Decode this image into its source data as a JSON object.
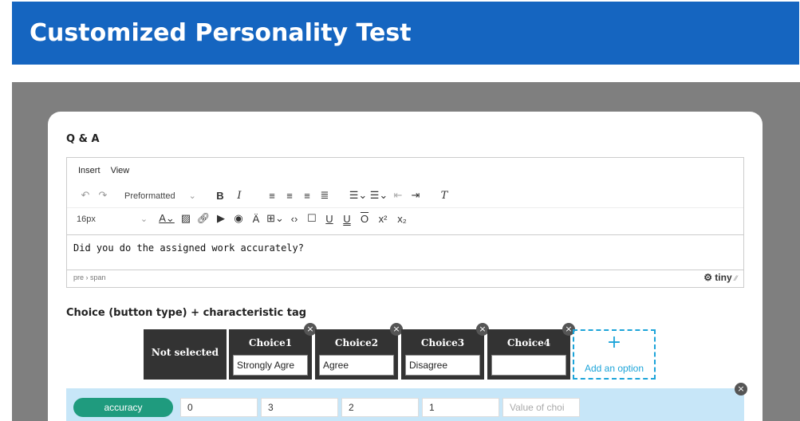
{
  "header": {
    "title": "Customized Personality Test"
  },
  "qa": {
    "label": "Q & A",
    "menu": [
      "Insert",
      "View"
    ],
    "toolbar": {
      "format_select": "Preformatted",
      "size_select": "16px"
    },
    "content": "Did you do the assigned work accurately?",
    "statusbar_path": "pre › span",
    "brand": "tiny"
  },
  "choices": {
    "label": "Choice (button type) + characteristic tag",
    "not_selected": "Not selected",
    "items": [
      {
        "name": "Choice1",
        "value": "Strongly Agre"
      },
      {
        "name": "Choice2",
        "value": "Agree"
      },
      {
        "name": "Choice3",
        "value": "Disagree"
      },
      {
        "name": "Choice4",
        "value": ""
      }
    ],
    "add_option": "Add an option",
    "add_icon": "+"
  },
  "tag_row": {
    "tag": "accuracy",
    "values": [
      "0",
      "3",
      "2",
      "1"
    ],
    "placeholder": "Value of choi"
  },
  "colors": {
    "header": "#1565c0",
    "choice_bg": "#333333",
    "tag": "#1f9b7e",
    "add_border": "#1ca4d9",
    "tag_row_bg": "#c7e6f8"
  }
}
